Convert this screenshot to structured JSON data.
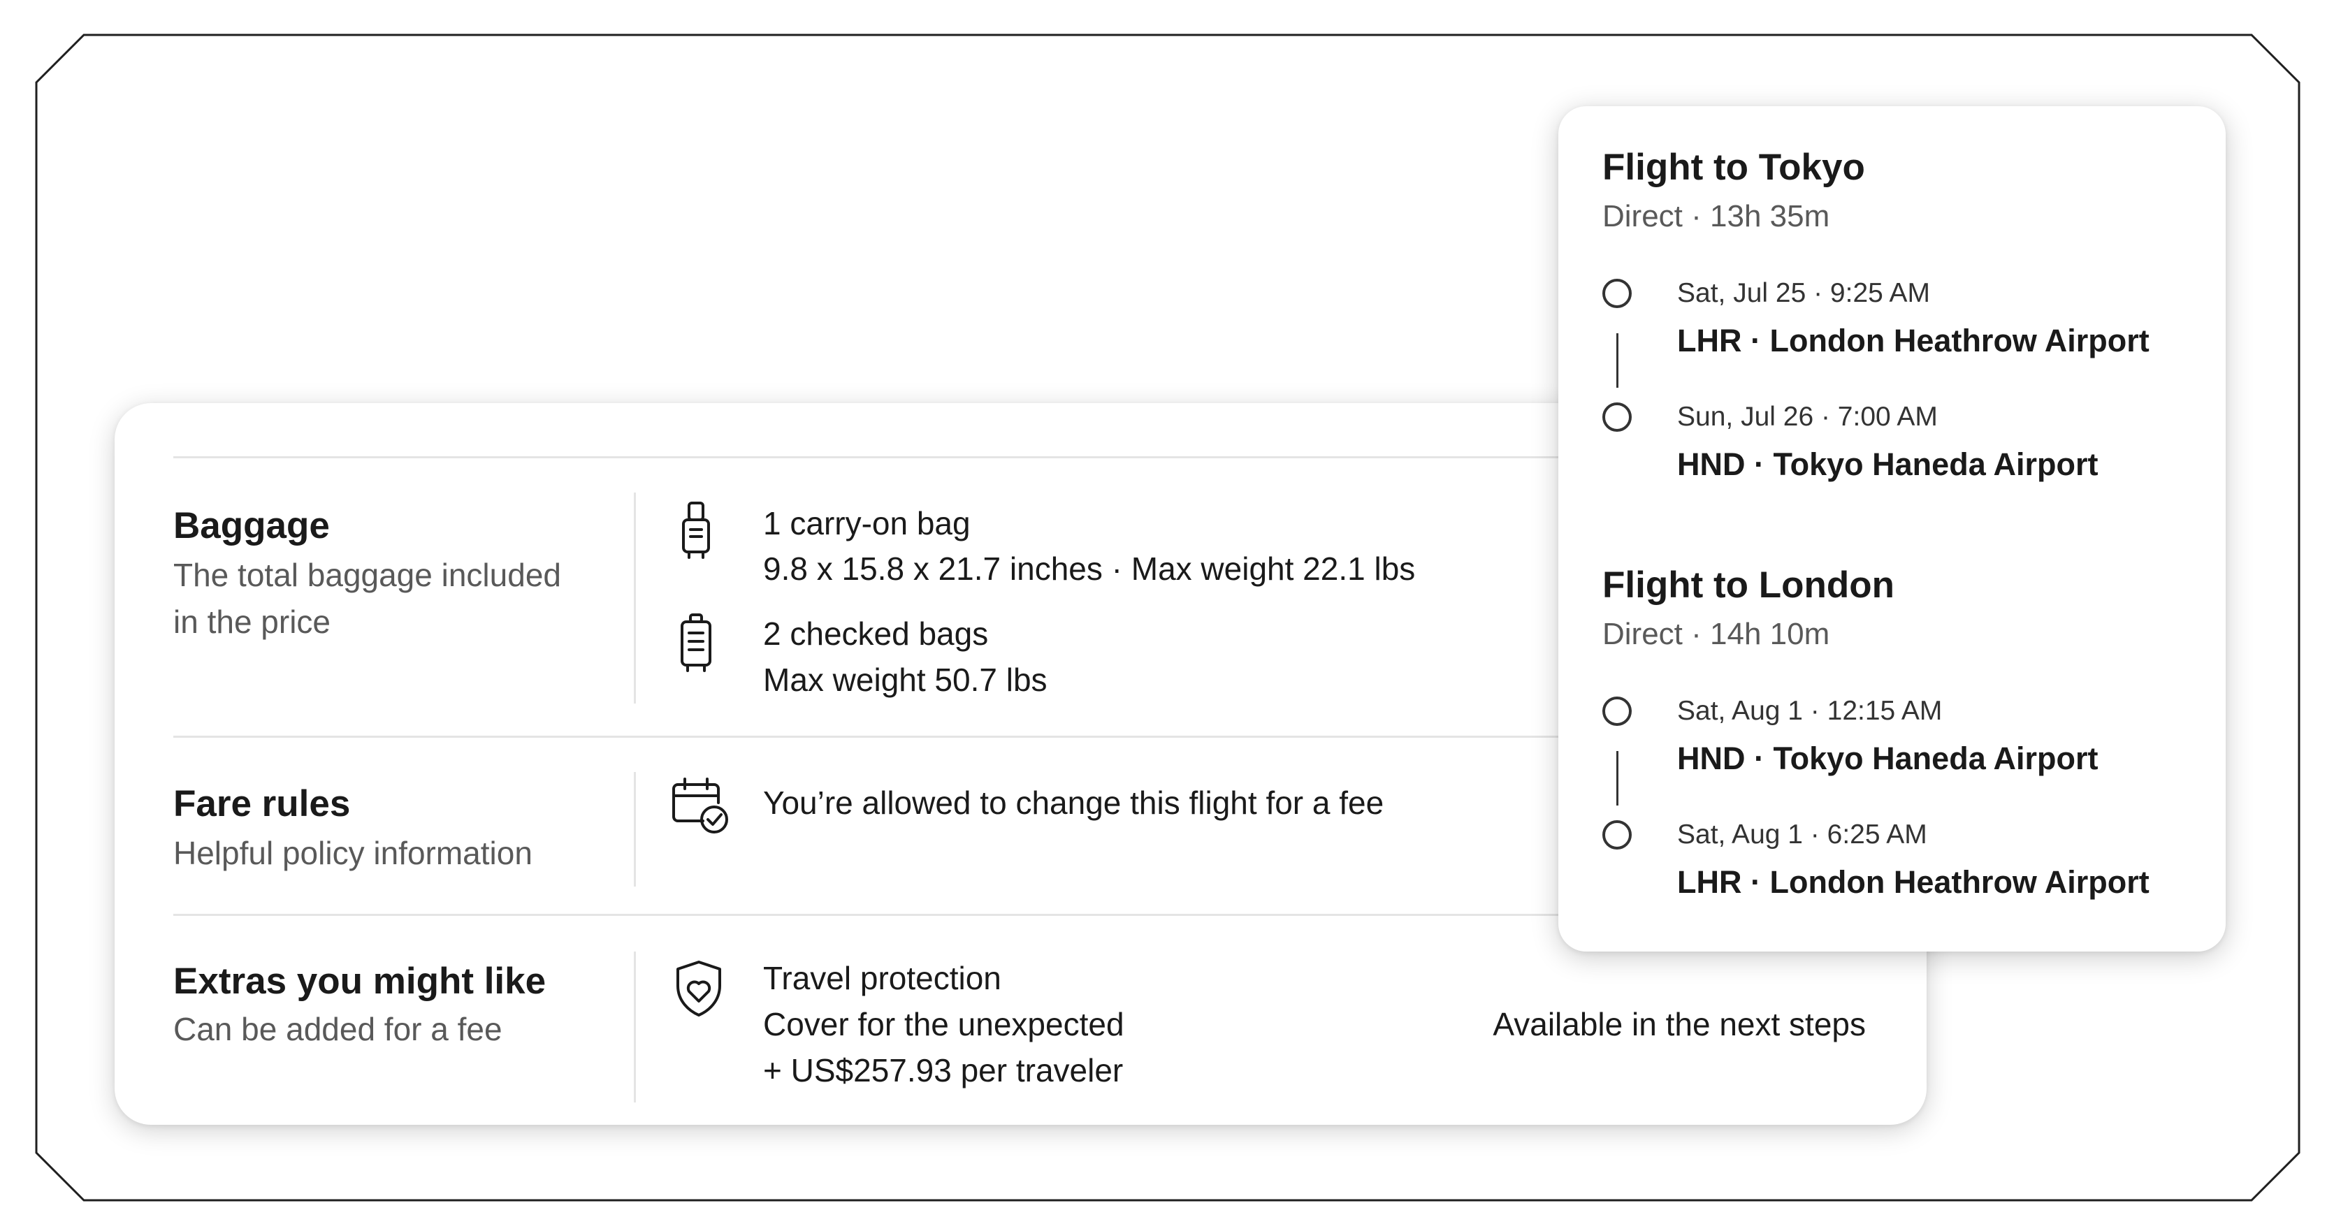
{
  "details": {
    "baggage": {
      "title": "Baggage",
      "subtitle": "The total baggage included in the price",
      "items": [
        {
          "icon": "carry-on-bag-icon",
          "line1": "1 carry-on bag",
          "line2": "9.8 x 15.8 x 21.7 inches · Max weight 22.1 lbs"
        },
        {
          "icon": "checked-bag-icon",
          "line1": "2 checked bags",
          "line2": "Max weight 50.7 lbs"
        }
      ]
    },
    "fare_rules": {
      "title": "Fare rules",
      "subtitle": "Helpful policy information",
      "icon": "calendar-check-icon",
      "text": "You’re allowed to change this flight for a fee"
    },
    "extras": {
      "title": "Extras you might like",
      "subtitle": "Can be added for a fee",
      "icon": "shield-heart-icon",
      "line1": "Travel protection",
      "line2": "Cover for the unexpected",
      "line3": "+ US$257.93 per traveler",
      "availability": "Available in the next steps"
    }
  },
  "itinerary": {
    "legs": [
      {
        "title": "Flight to Tokyo",
        "subtitle": "Direct · 13h 35m",
        "stops": [
          {
            "time": "Sat, Jul 25 · 9:25 AM",
            "airport": "LHR · London Heathrow Airport"
          },
          {
            "time": "Sun, Jul 26 · 7:00 AM",
            "airport": "HND · Tokyo Haneda Airport"
          }
        ]
      },
      {
        "title": "Flight to London",
        "subtitle": "Direct · 14h 10m",
        "stops": [
          {
            "time": "Sat, Aug 1 · 12:15 AM",
            "airport": "HND · Tokyo Haneda Airport"
          },
          {
            "time": "Sat, Aug 1 · 6:25 AM",
            "airport": "LHR · London Heathrow Airport"
          }
        ]
      }
    ]
  }
}
